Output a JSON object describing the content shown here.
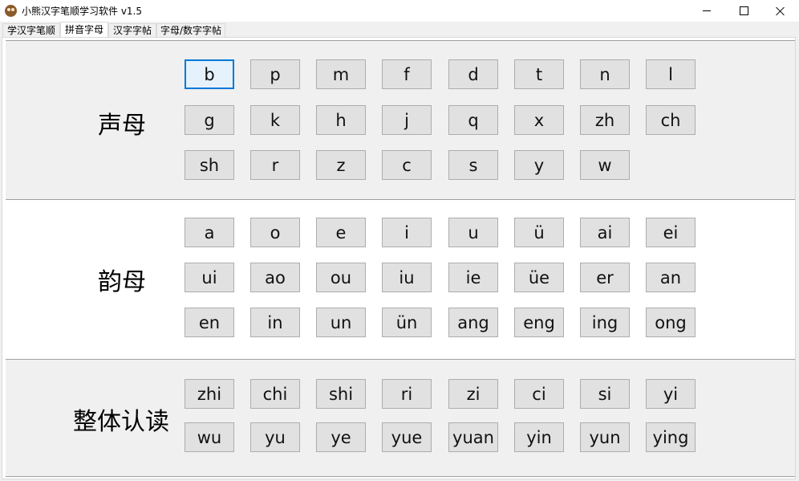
{
  "window": {
    "title": "小熊汉字笔顺学习软件 v1.5",
    "controls": {
      "minimize": "─",
      "maximize": "☐",
      "close": "✕"
    }
  },
  "tabs": [
    {
      "label": "学汉字笔顺",
      "active": false
    },
    {
      "label": "拼音字母",
      "active": true
    },
    {
      "label": "汉字字帖",
      "active": false
    },
    {
      "label": "字母/数字字帖",
      "active": false
    }
  ],
  "groups": {
    "shengmu": {
      "label": "声母",
      "rows": [
        [
          "b",
          "p",
          "m",
          "f",
          "d",
          "t",
          "n",
          "l"
        ],
        [
          "g",
          "k",
          "h",
          "j",
          "q",
          "x",
          "zh",
          "ch"
        ],
        [
          "sh",
          "r",
          "z",
          "c",
          "s",
          "y",
          "w"
        ]
      ]
    },
    "yunmu": {
      "label": "韵母",
      "rows": [
        [
          "a",
          "o",
          "e",
          "i",
          "u",
          "ü",
          "ai",
          "ei"
        ],
        [
          "ui",
          "ao",
          "ou",
          "iu",
          "ie",
          "üe",
          "er",
          "an"
        ],
        [
          "en",
          "in",
          "un",
          "ün",
          "ang",
          "eng",
          "ing",
          "ong"
        ]
      ]
    },
    "zhengti": {
      "label": "整体认读",
      "rows": [
        [
          "zhi",
          "chi",
          "shi",
          "ri",
          "zi",
          "ci",
          "si",
          "yi"
        ],
        [
          "wu",
          "yu",
          "ye",
          "yue",
          "yuan",
          "yin",
          "yun",
          "ying"
        ]
      ]
    }
  },
  "colors": {
    "focus": "#0078d7",
    "button_bg": "#e1e1e1",
    "group_bg": "#f0f0f0"
  }
}
